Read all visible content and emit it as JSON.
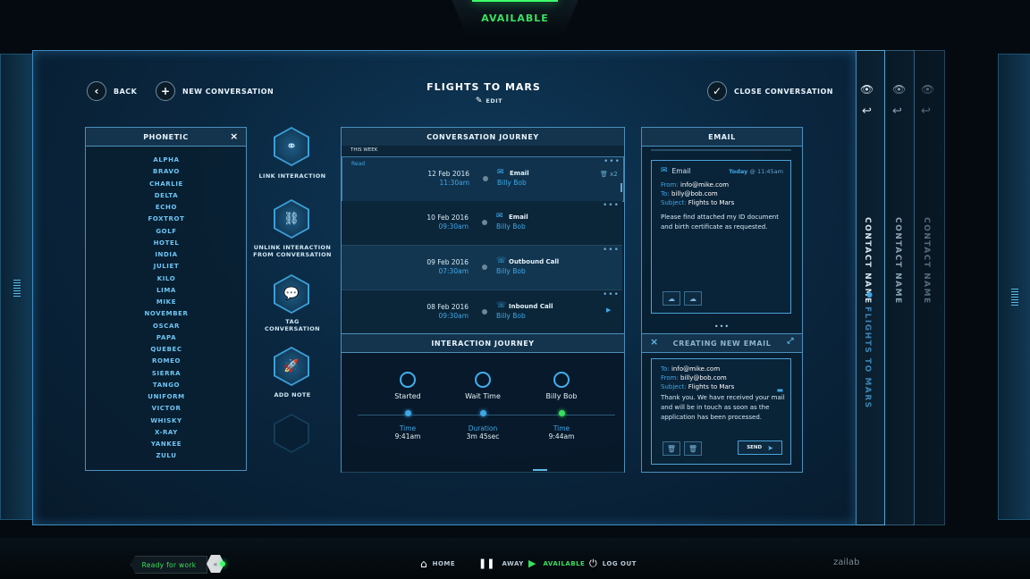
{
  "status": {
    "top": "AVAILABLE"
  },
  "header": {
    "back": "BACK",
    "new_conversation": "NEW CONVERSATION",
    "title": "FLIGHTS TO MARS",
    "edit": "EDIT",
    "close_conversation": "CLOSE CONVERSATION"
  },
  "phonetic": {
    "title": "PHONETIC",
    "words": [
      "ALPHA",
      "BRAVO",
      "CHARLIE",
      "DELTA",
      "ECHO",
      "FOXTROT",
      "GOLF",
      "HOTEL",
      "INDIA",
      "JULIET",
      "KILO",
      "LIMA",
      "MIKE",
      "NOVEMBER",
      "OSCAR",
      "PAPA",
      "QUEBEC",
      "ROMEO",
      "SIERRA",
      "TANGO",
      "UNIFORM",
      "VICTOR",
      "WHISKY",
      "X-RAY",
      "YANKEE",
      "ZULU"
    ]
  },
  "tools": {
    "link": "LINK INTERACTION",
    "unlink_1": "UNLINK INTERACTION",
    "unlink_2": "FROM CONVERSATION",
    "tag_1": "TAG",
    "tag_2": "CONVERSATION",
    "add_note": "ADD NOTE"
  },
  "journey": {
    "title": "CONVERSATION JOURNEY",
    "week": "THIS WEEK",
    "rows": [
      {
        "status": "Read",
        "date": "12 Feb 2016",
        "time": "11:30am",
        "type": "Email",
        "name": "Billy Bob",
        "extra": "x2"
      },
      {
        "status": "",
        "date": "10 Feb 2016",
        "time": "09:30am",
        "type": "Email",
        "name": "Billy Bob",
        "extra": ""
      },
      {
        "status": "",
        "date": "09 Feb 2016",
        "time": "07:30am",
        "type": "Outbound Call",
        "name": "Billy Bob",
        "extra": ""
      },
      {
        "status": "",
        "date": "08 Feb 2016",
        "time": "09:30am",
        "type": "Inbound Call",
        "name": "Billy Bob",
        "extra": ""
      }
    ]
  },
  "interaction": {
    "title": "INTERACTION JOURNEY",
    "steps": [
      {
        "label": "Started",
        "key": "Time",
        "value": "9:41am"
      },
      {
        "label": "Wait Time",
        "key": "Duration",
        "value": "3m 45sec"
      },
      {
        "label": "Billy Bob",
        "key": "Time",
        "value": "9:44am"
      }
    ]
  },
  "email": {
    "title": "EMAIL",
    "card": {
      "type": "Email",
      "when_day": "Today",
      "when_time": "@ 11:45am",
      "from_label": "From:",
      "from": "info@mike.com",
      "to_label": "To:",
      "to": "billy@bob.com",
      "subject_label": "Subject:",
      "subject": "Flights to Mars",
      "body": "Please find attached my ID document and birth certificate as requested."
    },
    "new": {
      "title": "CREATING NEW EMAIL",
      "to_label": "To:",
      "to": "info@mike.com",
      "from_label": "From:",
      "from": "billy@bob.com",
      "subject_label": "Subject:",
      "subject": "Flights to Mars",
      "body": "Thank you. We have received your mail and will be in touch as soon as the application has been processed.",
      "send": "SEND"
    }
  },
  "side": {
    "contact_name": "CONTACT NAME",
    "flights": "FLIGHTS TO MARS"
  },
  "bottom": {
    "ready": "Ready for work",
    "home": "HOME",
    "away": "AWAY",
    "available": "AVAILABLE",
    "logout": "LOG OUT",
    "brand": "zailab"
  },
  "colors": {
    "accent": "#3fa7e6",
    "available": "#39e05f",
    "border": "#4a8fbc"
  }
}
